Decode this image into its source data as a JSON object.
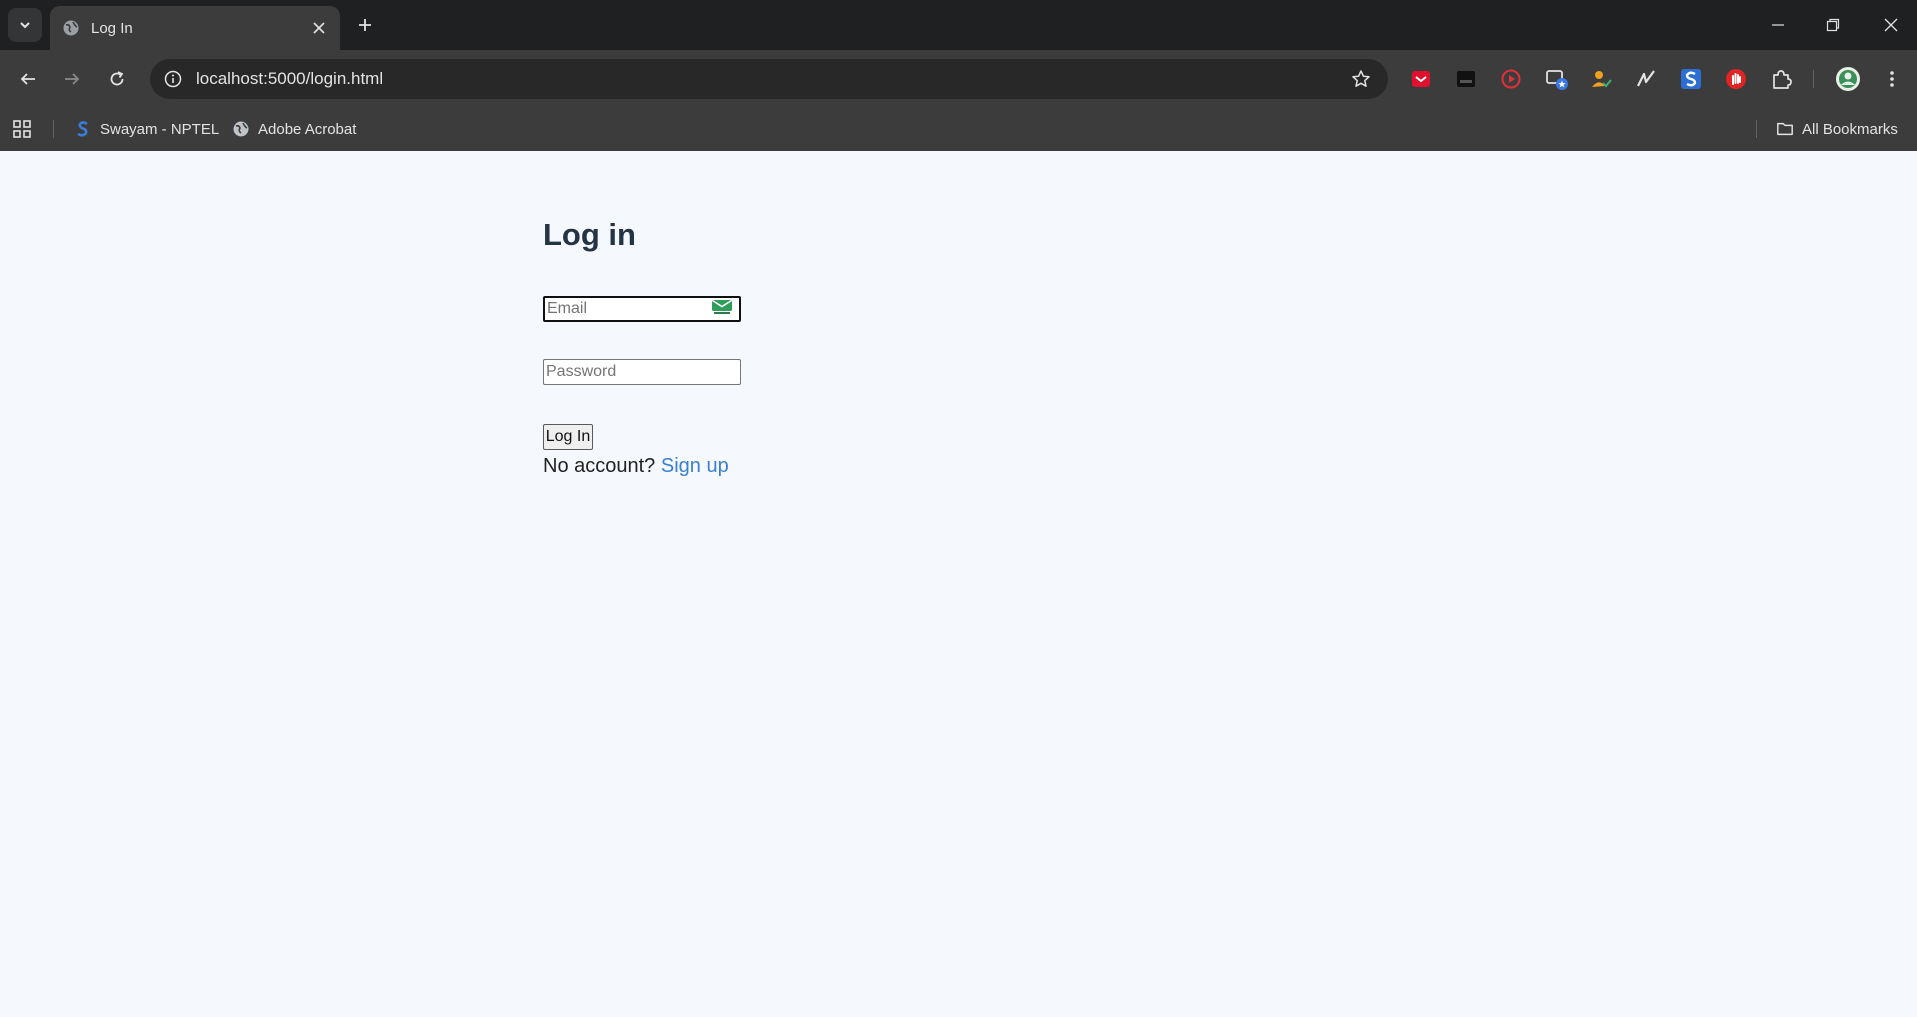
{
  "browser": {
    "tab": {
      "title": "Log In"
    },
    "address": {
      "url": "localhost:5000/login.html"
    },
    "bookmarks": [
      {
        "label": "Swayam - NPTEL"
      },
      {
        "label": "Adobe Acrobat"
      }
    ],
    "all_bookmarks_label": "All Bookmarks",
    "extensions": [
      "pocket-icon",
      "dark-ext-icon",
      "video-ext-icon",
      "screen-ext-icon",
      "user-check-ext-icon",
      "signature-ext-icon",
      "s-ext-icon",
      "hand-ext-icon",
      "puzzle-icon"
    ]
  },
  "page": {
    "title": "Log in",
    "email_placeholder": "Email",
    "password_placeholder": "Password",
    "login_button": "Log In",
    "no_account_text": "No account? ",
    "signup_link": "Sign up"
  },
  "colors": {
    "heading": "#243444",
    "link": "#3b7fd0",
    "page_bg": "#f5f8fc"
  }
}
